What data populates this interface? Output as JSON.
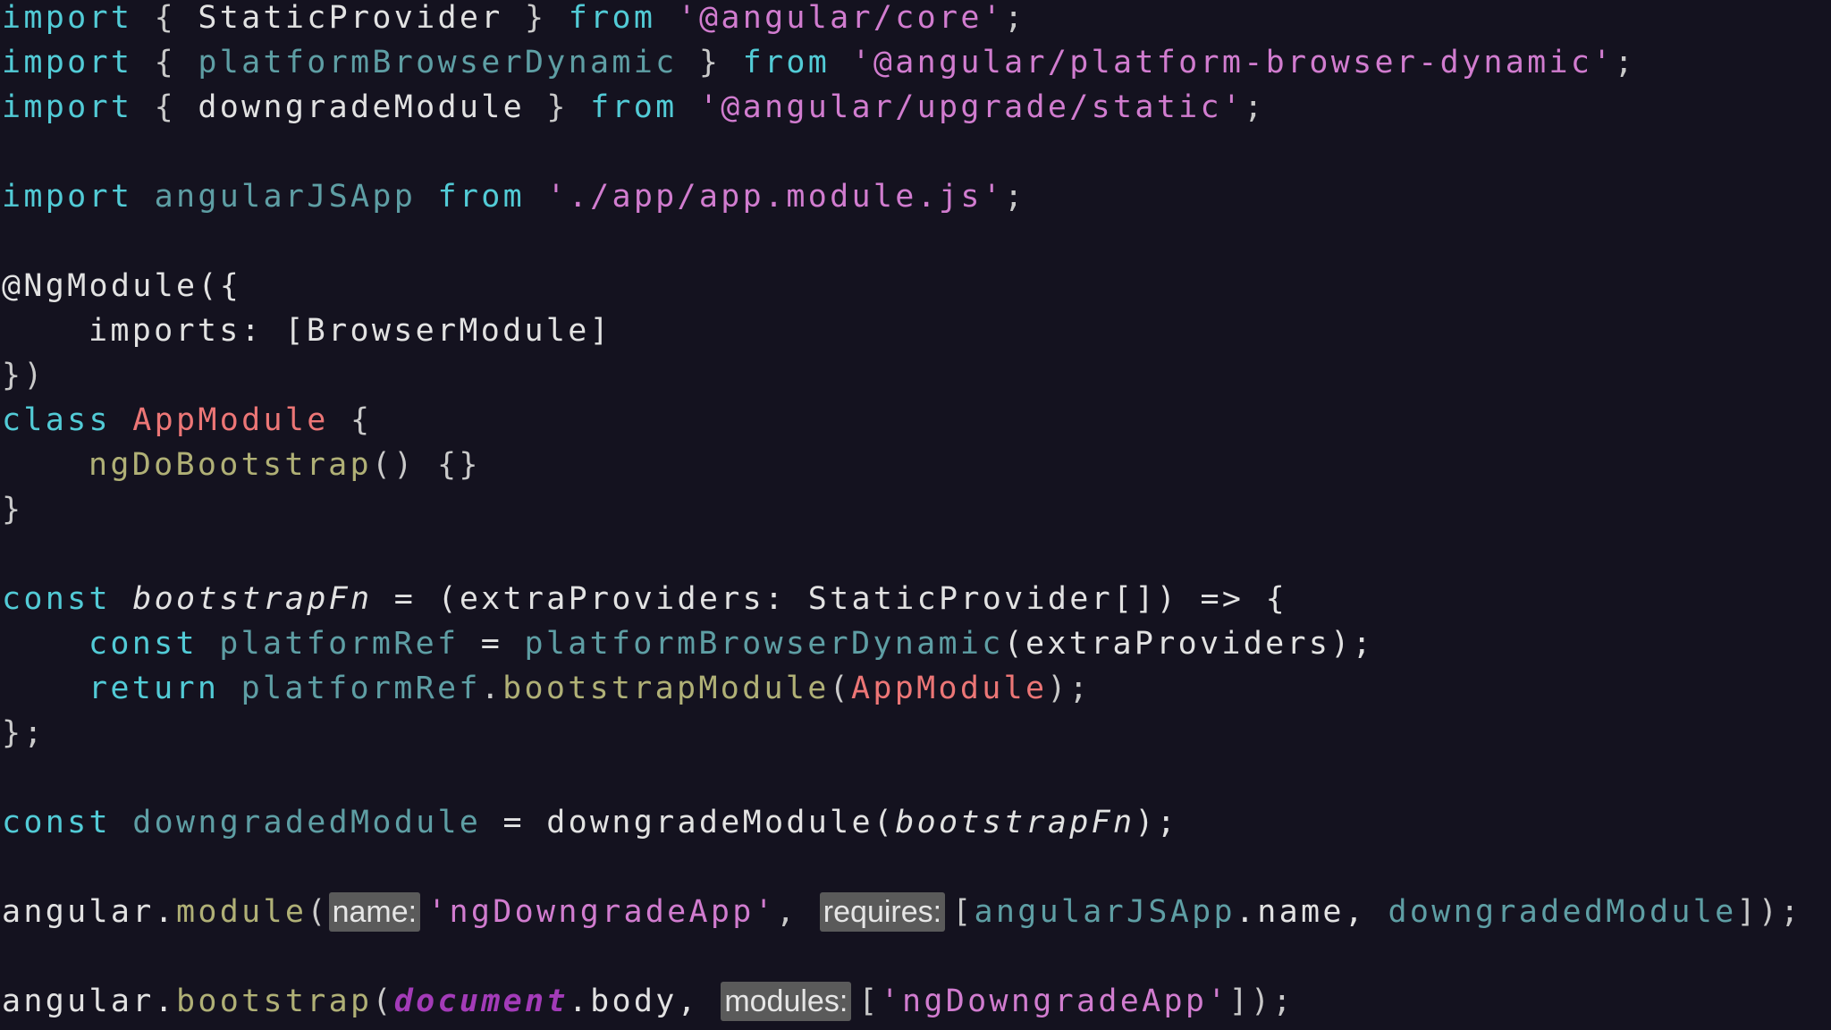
{
  "code": {
    "l1": {
      "kw_import": "import",
      "lb": "{",
      "name": "StaticProvider",
      "rb": "}",
      "kw_from": "from",
      "path": "'@angular/core'",
      "semi": ";"
    },
    "l2": {
      "kw_import": "import",
      "lb": "{",
      "name": "platformBrowserDynamic",
      "rb": "}",
      "kw_from": "from",
      "path": "'@angular/platform-browser-dynamic'",
      "semi": ";"
    },
    "l3": {
      "kw_import": "import",
      "lb": "{",
      "name": "downgradeModule",
      "rb": "}",
      "kw_from": "from",
      "path": "'@angular/upgrade/static'",
      "semi": ";"
    },
    "l5": {
      "kw_import": "import",
      "name": "angularJSApp",
      "kw_from": "from",
      "path": "'./app/app.module.js'",
      "semi": ";"
    },
    "l7": {
      "decorator": "@NgModule({"
    },
    "l8": {
      "key": "imports:",
      "value": "[BrowserModule]"
    },
    "l9": {
      "text": "})"
    },
    "l10": {
      "kw_class": "class",
      "name": "AppModule",
      "lb": "{"
    },
    "l11": {
      "method": "ngDoBootstrap",
      "rest": "() {}"
    },
    "l12": {
      "text": "}"
    },
    "l14": {
      "kw_const": "const",
      "name": "bootstrapFn",
      "rest": " = (extraProviders: StaticProvider[]) => {"
    },
    "l15": {
      "kw_const": "const",
      "name": "platformRef",
      "eq": " = ",
      "call": "platformBrowserDynamic",
      "args": "(extraProviders);"
    },
    "l16": {
      "kw_return": "return",
      "obj": "platformRef",
      "dot": ".",
      "method": "bootstrapModule",
      "lp": "(",
      "arg": "AppModule",
      "rp": ");"
    },
    "l17": {
      "text": "};"
    },
    "l19": {
      "kw_const": "const",
      "name": "downgradedModule",
      "eq": " = downgradeModule(",
      "arg": "bootstrapFn",
      "rp": ");"
    },
    "l21": {
      "obj": "angular.",
      "method": "module",
      "lp": "(",
      "hint_name": "name:",
      "str": "'ngDowngradeApp'",
      "comma": ", ",
      "hint_requires": "requires:",
      "lb": "[",
      "dep1": "angularJSApp",
      "dep1_prop": ".name, ",
      "dep2": "downgradedModule",
      "rb": "]);"
    },
    "l23": {
      "obj": "angular.",
      "method": "bootstrap",
      "lp": "(",
      "doc": "document",
      "prop": ".body, ",
      "hint_modules": "modules:",
      "lb": "[",
      "str": "'ngDowngradeApp'",
      "rb": "]);"
    }
  },
  "colors": {
    "background": "#14121f",
    "keyword": "#52cbd6",
    "string": "#d17ccf",
    "class_name": "#ec7676",
    "function_name": "#b0b076",
    "dim_identifier": "#5e9ea4",
    "inlay_hint_bg": "#5a5a5a"
  }
}
